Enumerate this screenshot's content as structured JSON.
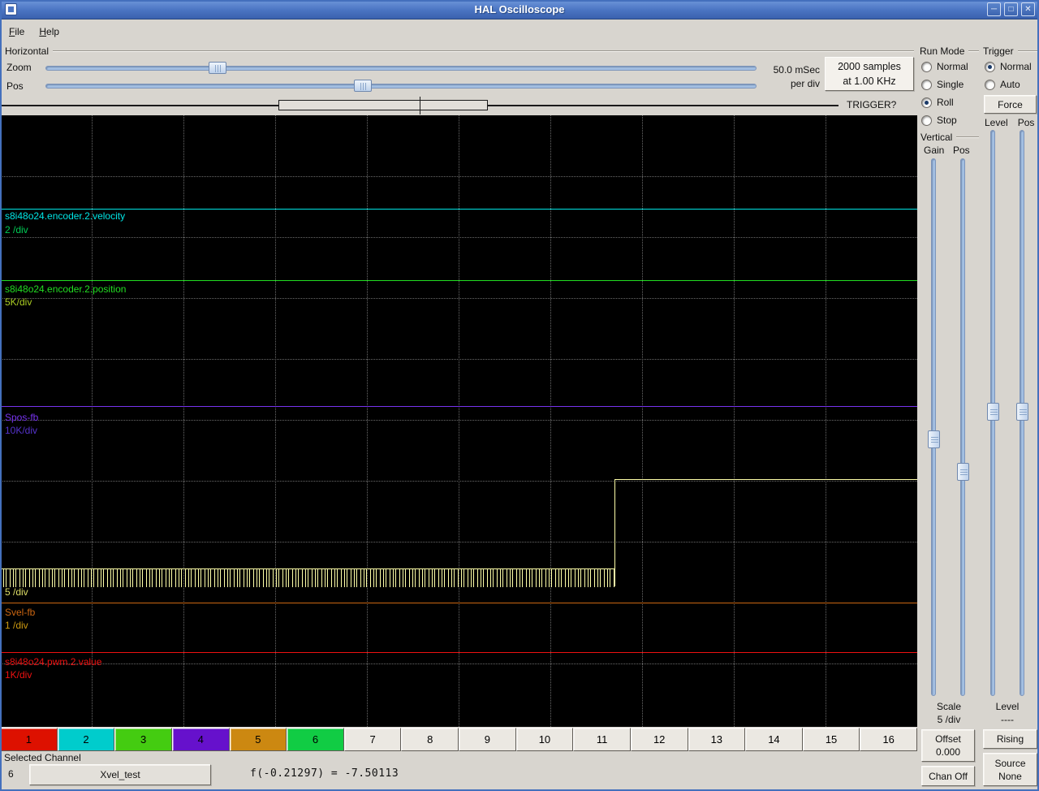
{
  "titlebar": {
    "title": "HAL Oscilloscope",
    "icons": {
      "minimize": "─",
      "maximize": "□",
      "close": "✕"
    }
  },
  "menubar": {
    "items": [
      "File",
      "Help"
    ]
  },
  "horizontal": {
    "label": "Horizontal",
    "zoom_label": "Zoom",
    "pos_label": "Pos",
    "rate_line1": "50.0 mSec",
    "rate_line2": "per div",
    "samples_line1": "2000 samples",
    "samples_line2": "at 1.00 KHz"
  },
  "record": {
    "trigger_label": "TRIGGER?"
  },
  "run_mode": {
    "label": "Run Mode",
    "options": [
      {
        "label": "Normal",
        "selected": false
      },
      {
        "label": "Single",
        "selected": false
      },
      {
        "label": "Roll",
        "selected": true
      },
      {
        "label": "Stop",
        "selected": false
      }
    ]
  },
  "trigger": {
    "label": "Trigger",
    "options": [
      {
        "label": "Normal",
        "selected": true
      },
      {
        "label": "Auto",
        "selected": false
      }
    ],
    "force_label": "Force",
    "level_col_label": "Level",
    "pos_col_label": "Pos",
    "level_label": "Level",
    "level_value": "----",
    "edge_label": "Rising",
    "source_label": "Source",
    "source_value": "None"
  },
  "vertical": {
    "label": "Vertical",
    "gain_label": "Gain",
    "pos_label": "Pos",
    "scale_label": "Scale",
    "scale_value": "5 /div",
    "offset_label": "Offset",
    "offset_value": "0.000",
    "chan_off_label": "Chan Off"
  },
  "scope": {
    "channels": [
      {
        "name": "s8i48o24.encoder.2.velocity",
        "scale": "2 /div",
        "color": "#00e6e6",
        "scale_color": "#00cc55"
      },
      {
        "name": "s8i48o24.encoder.2.position",
        "scale": "5K/div",
        "color": "#22dd22",
        "scale_color": "#aacc22"
      },
      {
        "name": "Spos-fb",
        "scale": "10K/div",
        "color": "#7733ee",
        "scale_color": "#5533cc"
      },
      {
        "name": "",
        "scale": "5 /div",
        "color": "#ffffaa",
        "scale_color": "#dddd66"
      },
      {
        "name": "Svel-fb",
        "scale": "1 /div",
        "color": "#cc6611",
        "scale_color": "#cc9911"
      },
      {
        "name": "s8i48o24.pwm.2.value",
        "scale": "1K/div",
        "color": "#ee1111",
        "scale_color": "#ee1111"
      }
    ]
  },
  "channel_buttons": [
    {
      "label": "1",
      "color": "#dd1100"
    },
    {
      "label": "2",
      "color": "#00cccc"
    },
    {
      "label": "3",
      "color": "#44cc11"
    },
    {
      "label": "4",
      "color": "#6611cc"
    },
    {
      "label": "5",
      "color": "#cc8811"
    },
    {
      "label": "6",
      "color": "#11cc44"
    },
    {
      "label": "7",
      "color": "#ebe8e2"
    },
    {
      "label": "8",
      "color": "#ebe8e2"
    },
    {
      "label": "9",
      "color": "#ebe8e2"
    },
    {
      "label": "10",
      "color": "#ebe8e2"
    },
    {
      "label": "11",
      "color": "#ebe8e2"
    },
    {
      "label": "12",
      "color": "#ebe8e2"
    },
    {
      "label": "13",
      "color": "#ebe8e2"
    },
    {
      "label": "14",
      "color": "#ebe8e2"
    },
    {
      "label": "15",
      "color": "#ebe8e2"
    },
    {
      "label": "16",
      "color": "#ebe8e2"
    }
  ],
  "status": {
    "selected_label": "Selected Channel",
    "channel_number": "6",
    "channel_name": "Xvel_test",
    "readout": "f(-0.21297) = -7.50113"
  }
}
